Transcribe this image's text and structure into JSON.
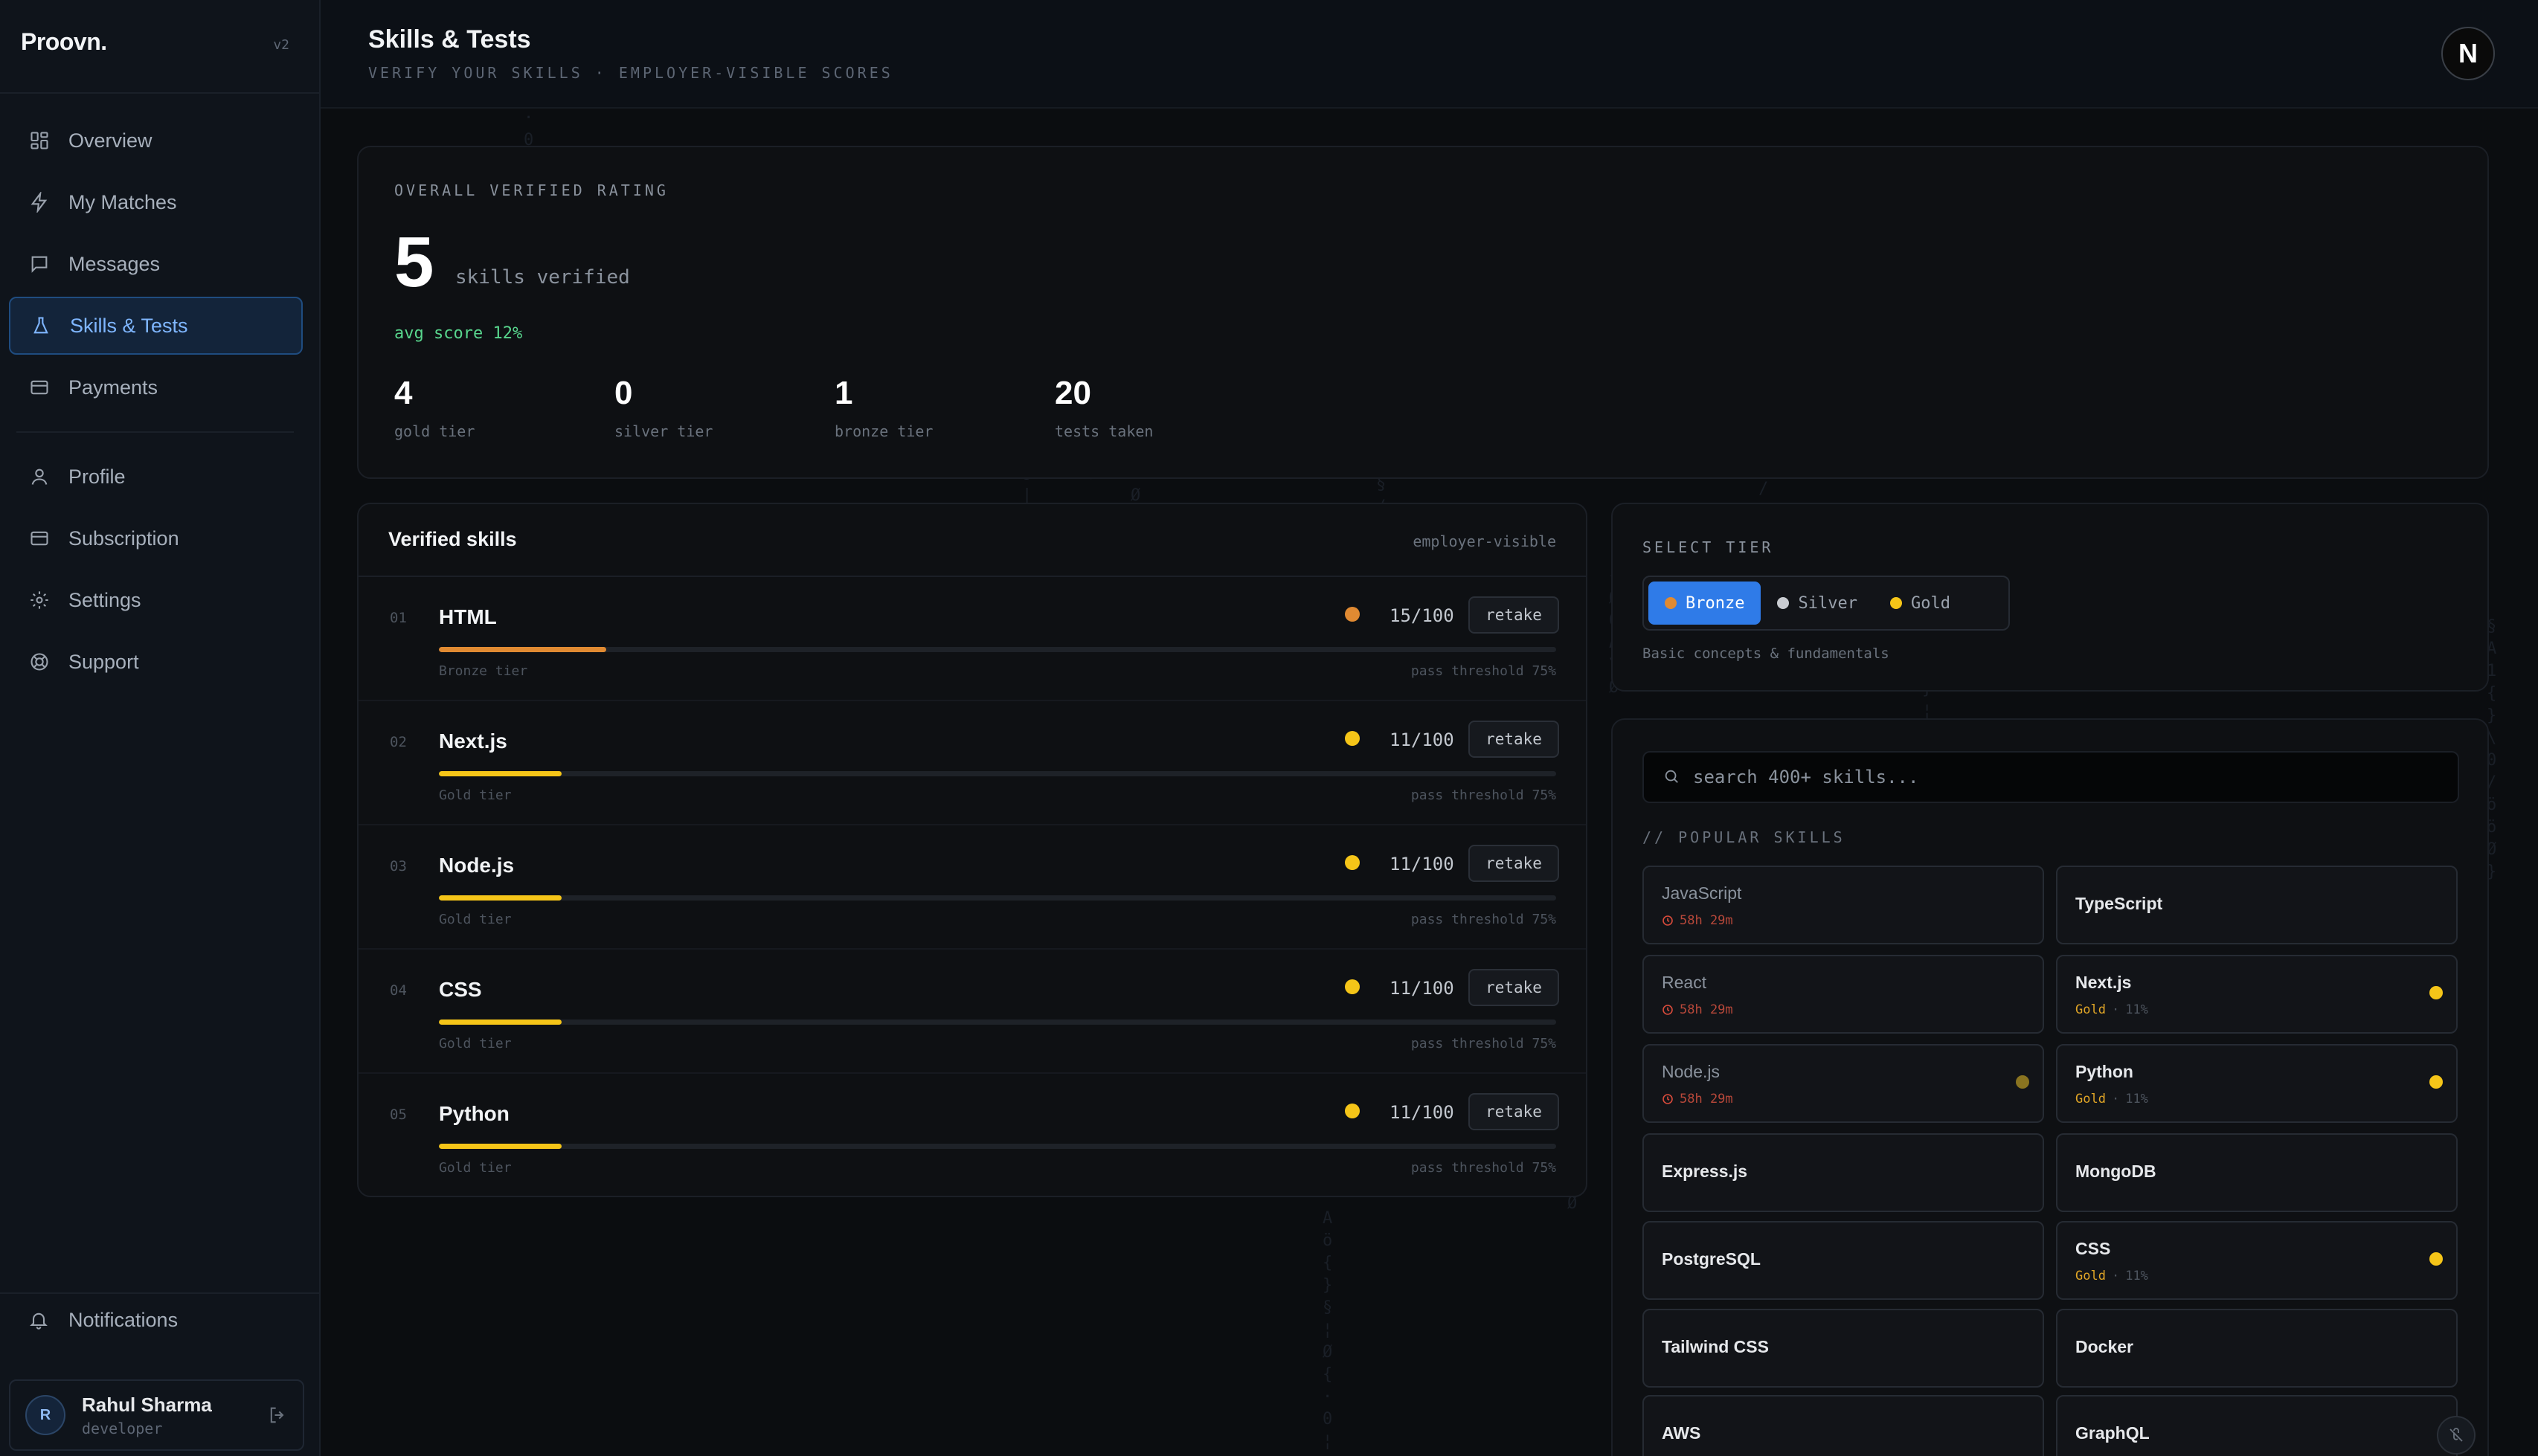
{
  "app": {
    "brand": "Proovn.",
    "version": "v2"
  },
  "sidebar": {
    "items": [
      {
        "label": "Overview",
        "icon": "grid-icon"
      },
      {
        "label": "My Matches",
        "icon": "lightning-icon"
      },
      {
        "label": "Messages",
        "icon": "chat-icon"
      },
      {
        "label": "Skills & Tests",
        "icon": "flask-icon",
        "active": true
      },
      {
        "label": "Payments",
        "icon": "card-icon"
      }
    ],
    "secondary": [
      {
        "label": "Profile",
        "icon": "user-icon"
      },
      {
        "label": "Subscription",
        "icon": "card-icon"
      },
      {
        "label": "Settings",
        "icon": "gear-icon"
      },
      {
        "label": "Support",
        "icon": "lifebuoy-icon"
      }
    ],
    "notifications": "Notifications",
    "user": {
      "initial": "R",
      "name": "Rahul Sharma",
      "role": "developer"
    }
  },
  "header": {
    "title": "Skills & Tests",
    "subtitle": "VERIFY YOUR SKILLS · EMPLOYER-VISIBLE SCORES",
    "avatar": "N"
  },
  "rating": {
    "label": "OVERALL VERIFIED RATING",
    "count": "5",
    "count_label": "skills verified",
    "avg": "avg score 12%",
    "stats": [
      {
        "value": "4",
        "label": "gold tier"
      },
      {
        "value": "0",
        "label": "silver tier"
      },
      {
        "value": "1",
        "label": "bronze tier"
      },
      {
        "value": "20",
        "label": "tests taken"
      }
    ]
  },
  "verified": {
    "title": "Verified skills",
    "tag": "employer-visible",
    "retake_label": "retake",
    "threshold": "pass threshold 75%",
    "rows": [
      {
        "idx": "01",
        "name": "HTML",
        "score": "15/100",
        "progress": 0.15,
        "tier": "Bronze tier",
        "color": "#e08a32"
      },
      {
        "idx": "02",
        "name": "Next.js",
        "score": "11/100",
        "progress": 0.11,
        "tier": "Gold tier",
        "color": "#f5c518"
      },
      {
        "idx": "03",
        "name": "Node.js",
        "score": "11/100",
        "progress": 0.11,
        "tier": "Gold tier",
        "color": "#f5c518"
      },
      {
        "idx": "04",
        "name": "CSS",
        "score": "11/100",
        "progress": 0.11,
        "tier": "Gold tier",
        "color": "#f5c518"
      },
      {
        "idx": "05",
        "name": "Python",
        "score": "11/100",
        "progress": 0.11,
        "tier": "Gold tier",
        "color": "#f5c518"
      }
    ]
  },
  "tier": {
    "label": "SELECT TIER",
    "options": [
      {
        "label": "Bronze",
        "color": "#e08a32",
        "active": true
      },
      {
        "label": "Silver",
        "color": "#c9ccd1"
      },
      {
        "label": "Gold",
        "color": "#f5c518"
      }
    ],
    "description": "Basic concepts & fundamentals"
  },
  "catalog": {
    "search_placeholder": "search 400+ skills...",
    "popular_label": "// POPULAR SKILLS",
    "skills": [
      {
        "name": "JavaScript",
        "cooldown": "58h 29m",
        "dim": true
      },
      {
        "name": "TypeScript"
      },
      {
        "name": "React",
        "cooldown": "58h 29m",
        "dim": true
      },
      {
        "name": "Next.js",
        "tier": "Gold",
        "pct": "11%",
        "dot": "#f5c518"
      },
      {
        "name": "Node.js",
        "cooldown": "58h 29m",
        "dim": true,
        "dot": "#8a7420"
      },
      {
        "name": "Python",
        "tier": "Gold",
        "pct": "11%",
        "dot": "#f5c518"
      },
      {
        "name": "Express.js"
      },
      {
        "name": "MongoDB"
      },
      {
        "name": "PostgreSQL"
      },
      {
        "name": "CSS",
        "tier": "Gold",
        "pct": "11%",
        "dot": "#f5c518"
      },
      {
        "name": "Tailwind CSS"
      },
      {
        "name": "Docker"
      },
      {
        "name": "AWS"
      },
      {
        "name": "GraphQL"
      }
    ]
  },
  "colors": {
    "accent": "#2f7be8",
    "gold": "#f5c518",
    "bronze": "#e08a32",
    "success": "#58d68d"
  }
}
